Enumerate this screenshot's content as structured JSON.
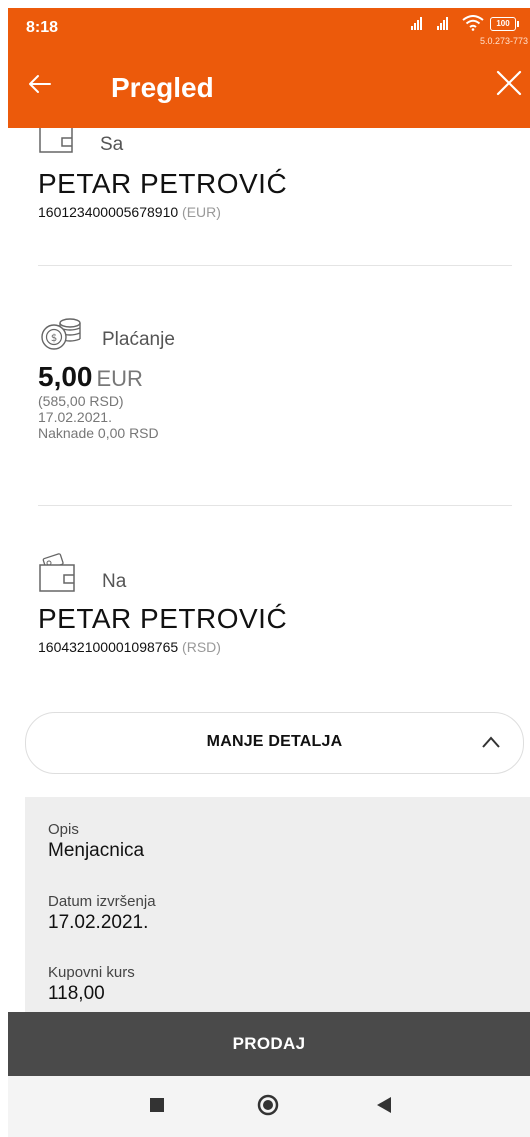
{
  "status": {
    "time": "8:18",
    "battery": "100",
    "version": "5.0.273-773"
  },
  "appbar": {
    "title": "Pregled"
  },
  "from": {
    "label": "Sa",
    "name": "PETAR PETROVIĆ",
    "account": "160123400005678910",
    "currency": "(EUR)"
  },
  "payment": {
    "label": "Plaćanje",
    "amount": "5,00",
    "currency": "EUR",
    "converted": "(585,00 RSD)",
    "date": "17.02.2021.",
    "fees": "Naknade 0,00 RSD"
  },
  "to": {
    "label": "Na",
    "name": "PETAR PETROVIĆ",
    "account": "160432100001098765",
    "currency": "(RSD)"
  },
  "toggle": {
    "label": "MANJE DETALJA"
  },
  "details": [
    {
      "key": "Opis",
      "value": "Menjacnica"
    },
    {
      "key": "Datum izvršenja",
      "value": "17.02.2021."
    },
    {
      "key": "Kupovni kurs",
      "value": "118,00"
    }
  ],
  "sell": {
    "label": "PRODAJ"
  },
  "colors": {
    "brand": "#ec5a0b",
    "sell_bar": "#4a4a4a"
  }
}
